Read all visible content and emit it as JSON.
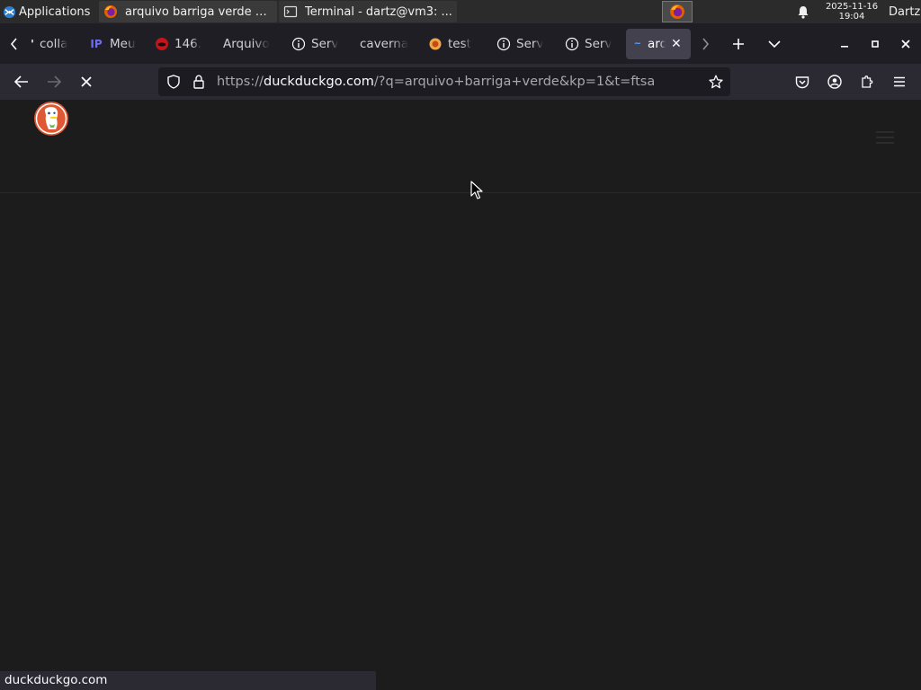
{
  "taskbar": {
    "app_menu_label": "Applications",
    "tasks": [
      {
        "label": "arquivo barriga verde at...",
        "icon": "firefox-icon"
      },
      {
        "label": "Terminal - dartz@vm3: ...",
        "icon": "terminal-icon"
      }
    ],
    "clock_date": "2025-11-16",
    "clock_time": "19:04",
    "user": "Dartz"
  },
  "tabs": [
    {
      "label": "colla",
      "icon": "collab-icon"
    },
    {
      "label": "Meu",
      "icon": "ip-icon",
      "icon_text": "IP"
    },
    {
      "label": "146.",
      "icon": "red-mouth-icon"
    },
    {
      "label": "Arquivo",
      "icon": "none"
    },
    {
      "label": "Serv",
      "icon": "info-icon"
    },
    {
      "label": "caverna",
      "icon": "none"
    },
    {
      "label": "test",
      "icon": "tor-icon"
    },
    {
      "label": "Serv",
      "icon": "info-icon"
    },
    {
      "label": "Serv",
      "icon": "info-icon"
    },
    {
      "label": "arq",
      "icon": "ddg-tab-icon",
      "active": true
    }
  ],
  "navbar": {
    "url_prefix": "https://",
    "url_domain": "duckduckgo.com",
    "url_rest": "/?q=arquivo+barriga+verde&kp=1&t=ftsa"
  },
  "status": {
    "text": "duckduckgo.com"
  },
  "colors": {
    "tab_strip": "#1f1e25",
    "navbar": "#2b2a33",
    "page_bg": "#1c1c1c",
    "accent_ddg": "#de5833"
  }
}
